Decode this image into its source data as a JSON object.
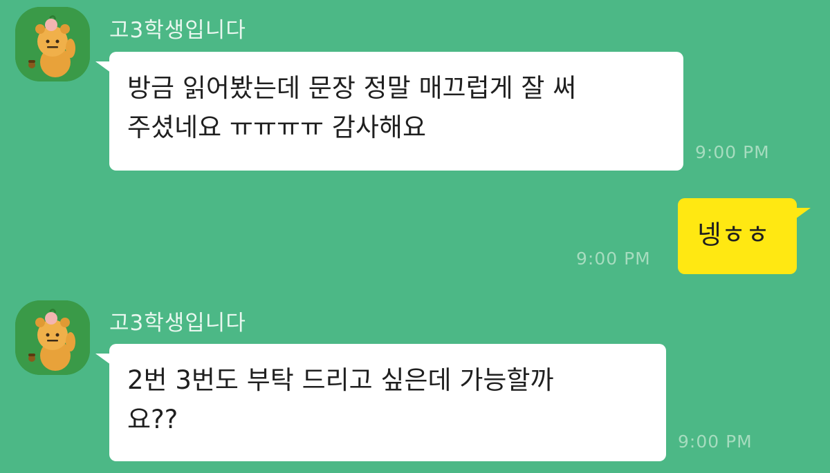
{
  "messages": [
    {
      "direction": "incoming",
      "sender": "고3학생입니다",
      "lines": [
        "방금 읽어봤는데 문장 정말 매끄럽게 잘 써",
        "주셨네요 ㅠㅠㅠㅠ 감사해요"
      ],
      "time": "9:00 PM"
    },
    {
      "direction": "outgoing",
      "lines": [
        "넹ㅎㅎ"
      ],
      "time": "9:00 PM"
    },
    {
      "direction": "incoming",
      "sender": "고3학생입니다",
      "lines": [
        "2번  3번도 부탁 드리고 싶은데 가능할까",
        "요??"
      ],
      "time": "9:00 PM"
    }
  ],
  "icons": {
    "avatar": "profile-avatar-icon"
  },
  "colors": {
    "background": "#4cb886",
    "incoming_bubble": "#ffffff",
    "outgoing_bubble": "#ffe812",
    "avatar_background": "#3a9a48"
  }
}
